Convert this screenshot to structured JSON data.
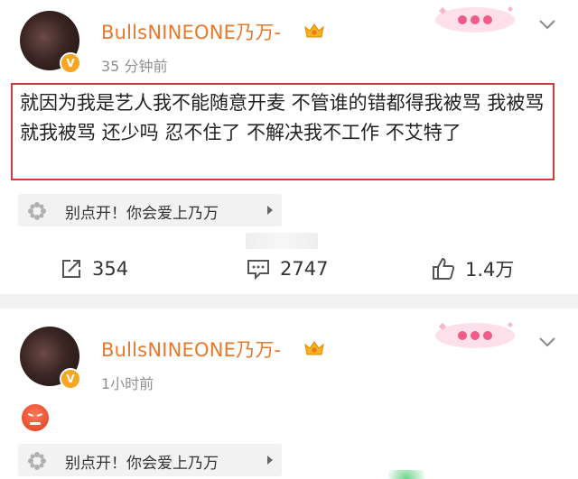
{
  "posts": [
    {
      "username": "BullsNINEONE乃万-",
      "timestamp": "35 分钟前",
      "content": "就因为我是艺人我不能随意开麦 不管谁的错都得我被骂 我被骂就我被骂 还少吗 忍不住了 不解决我不工作 不艾特了",
      "tag_label": "别点开！你会爱上乃万",
      "repost_count": "354",
      "comment_count": "2747",
      "like_count": "1.4万"
    },
    {
      "username": "BullsNINEONE乃万-",
      "timestamp": "1小时前",
      "tag_label": "别点开！你会爱上乃万"
    }
  ],
  "colors": {
    "username": "#e8782a",
    "highlight_border": "#d23b3b",
    "vip_badge": "#f6a623",
    "divider": "#f2f2f2"
  },
  "icons": {
    "verified_badge": "v-badge-icon",
    "member": "crown-icon",
    "menu": "chevron-down-icon",
    "tag": "flower-icon",
    "repost": "repost-icon",
    "comment": "comment-icon",
    "like": "thumbs-up-icon",
    "emoji": "angry-face-icon"
  }
}
